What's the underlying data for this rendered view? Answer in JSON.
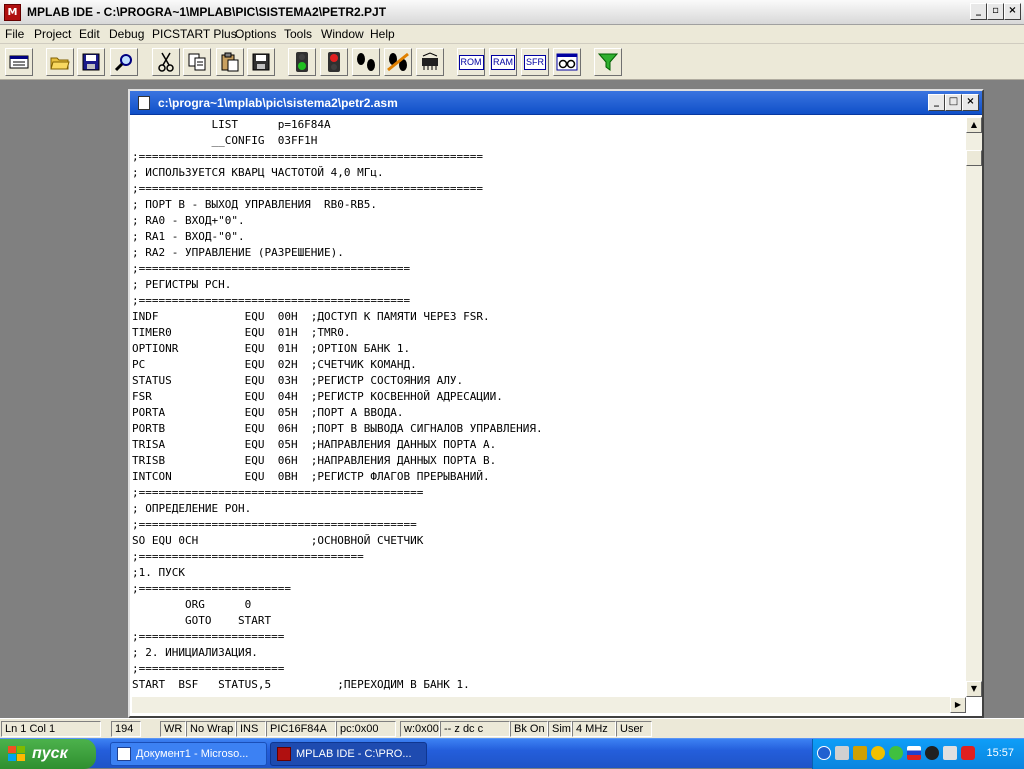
{
  "window": {
    "title": "MPLAB IDE - C:\\PROGRA~1\\MPLAB\\PIC\\SISTEMA2\\PETR2.PJT"
  },
  "menu": [
    "File",
    "Project",
    "Edit",
    "Debug",
    "PICSTART Plus",
    "Options",
    "Tools",
    "Window",
    "Help"
  ],
  "toolbar": {
    "text_buttons": [
      "ROM",
      "RAM",
      "SFR"
    ]
  },
  "editor": {
    "title": "c:\\progra~1\\mplab\\pic\\sistema2\\petr2.asm",
    "lines": [
      "            LIST      p=16F84A",
      "            __CONFIG  03FF1H",
      ";====================================================",
      "; ИСПОЛЬЗУЕТСЯ КВАРЦ ЧАСТОТОЙ 4,0 МГц.",
      ";====================================================",
      "; ПОРТ В - ВЫХОД УПРАВЛЕНИЯ  RB0-RB5.",
      "; RA0 - ВХОД+\"0\".",
      "; RA1 - ВХОД-\"0\".",
      "; RA2 - УПРАВЛЕНИЕ (РАЗРЕШЕНИЕ).",
      ";=========================================",
      "; РЕГИСТРЫ РСН.",
      ";=========================================",
      "INDF             EQU  00H  ;ДОСТУП К ПАМЯТИ ЧЕРЕЗ FSR.",
      "TIMER0           EQU  01H  ;TMR0.",
      "OPTIONR          EQU  01H  ;OPTION БАНК 1.",
      "PC               EQU  02H  ;СЧЕТЧИК КОМАНД.",
      "STATUS           EQU  03H  ;РЕГИСТР СОСТОЯНИЯ АЛУ.",
      "FSR              EQU  04H  ;РЕГИСТР КОСВЕННОЙ АДРЕСАЦИИ.",
      "PORTA            EQU  05H  ;ПОРТ А ВВОДА.",
      "PORTB            EQU  06H  ;ПОРТ В ВЫВОДА СИГНАЛОВ УПРАВЛЕНИЯ.",
      "TRISA            EQU  05H  ;НАПРАВЛЕНИЯ ДАННЫХ ПОРТА А.",
      "TRISB            EQU  06H  ;НАПРАВЛЕНИЯ ДАННЫХ ПОРТА В.",
      "INTCON           EQU  0BH  ;РЕГИСТР ФЛАГОВ ПРЕРЫВАНИЙ.",
      ";===========================================",
      "; ОПРЕДЕЛЕНИЕ РОН.",
      ";==========================================",
      "SO EQU 0CH                 ;ОСНОВНОЙ СЧЕТЧИК",
      ";==================================",
      ";1. ПУСК",
      ";=======================",
      "        ORG      0",
      "        GOTO    START",
      ";======================",
      "; 2. ИНИЦИАЛИЗАЦИЯ.",
      ";======================",
      "START  BSF   STATUS,5          ;ПЕРЕХОДИМ В БАНК 1."
    ]
  },
  "statusbar": {
    "position": "Ln 1 Col 1",
    "chars": "194",
    "wr": "WR",
    "wrap": "No Wrap",
    "ins": "INS",
    "device": "PIC16F84A",
    "pc": "pc:0x00",
    "w": "w:0x00",
    "flags": "-- z dc c",
    "bk": "Bk On",
    "sim": "Sim",
    "freq": "4 MHz",
    "user": "User"
  },
  "taskbar": {
    "start": "пуск",
    "tasks": [
      "Документ1 - Microso...",
      "MPLAB IDE - C:\\PRO..."
    ],
    "clock": "15:57"
  }
}
